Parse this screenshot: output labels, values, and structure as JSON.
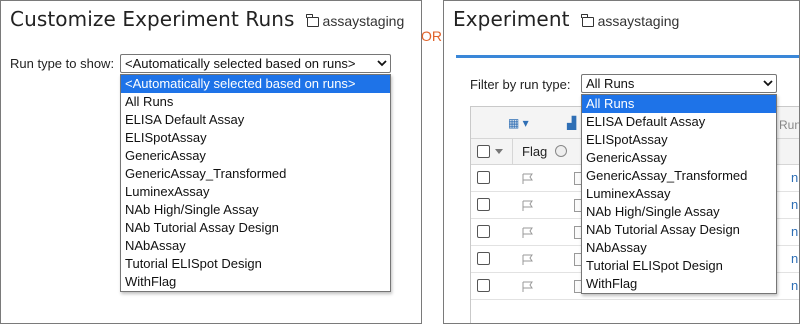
{
  "left": {
    "title": "Customize Experiment Runs",
    "folder": "assaystaging",
    "label": "Run type to show:",
    "selected": "<Automatically selected based on runs>",
    "options": [
      "<Automatically selected based on runs>",
      "All Runs",
      "ELISA Default Assay",
      "ELISpotAssay",
      "GenericAssay",
      "GenericAssay_Transformed",
      "LuminexAssay",
      "NAb High/Single Assay",
      "NAb Tutorial Assay Design",
      "NAbAssay",
      "Tutorial ELISpot Design",
      "WithFlag"
    ]
  },
  "or_text": "OR",
  "right": {
    "title": "Experiment",
    "folder": "assaystaging",
    "label": "Filter by run type:",
    "selected": "All Runs",
    "options": [
      "All Runs",
      "ELISA Default Assay",
      "ELISpotAssay",
      "GenericAssay",
      "GenericAssay_Transformed",
      "LuminexAssay",
      "NAb High/Single Assay",
      "NAb Tutorial Assay Design",
      "NAbAssay",
      "Tutorial ELISpot Design",
      "WithFlag"
    ],
    "grid": {
      "flag_header": "Flag",
      "runs_header_fragment": "Run",
      "row_link_fragment": "n"
    }
  },
  "colors": {
    "selected_option_bg": "#1e73e8",
    "or_color": "#e0632b",
    "accent_rule": "#3a87d8"
  }
}
